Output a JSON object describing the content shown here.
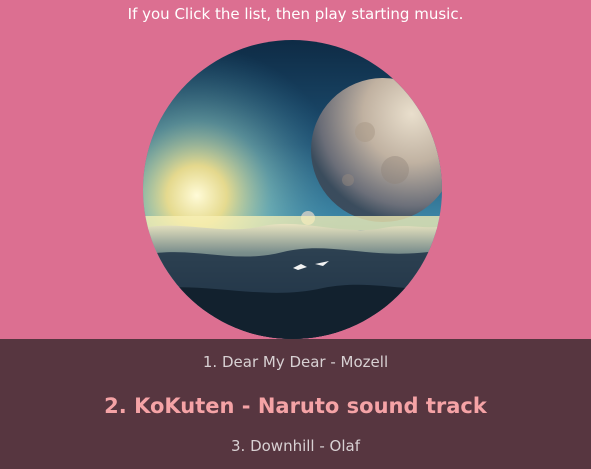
{
  "instruction": "If you Click the list, then play starting music.",
  "cover_art": {
    "description_icon": "album-cover-image"
  },
  "playlist": {
    "tracks": [
      {
        "label": "1. Dear My Dear - Mozell",
        "active": false
      },
      {
        "label": "2. KoKuten - Naruto sound track",
        "active": true
      },
      {
        "label": "3. Downhill - Olaf",
        "active": false
      }
    ]
  },
  "colors": {
    "background": "#DC6F91",
    "playlist_background": "#573640",
    "active_track": "#F5A3A6",
    "inactive_track": "#D8D1D3",
    "instruction_text": "#FFFFFF"
  }
}
